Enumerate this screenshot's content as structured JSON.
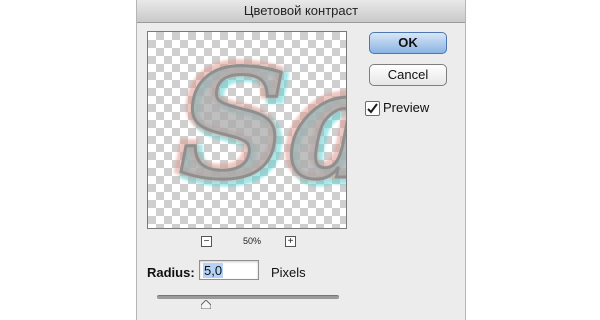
{
  "dialog": {
    "title": "Цветовой контраст",
    "ok_label": "OK",
    "cancel_label": "Cancel",
    "preview_label": "Preview",
    "preview_checked": true
  },
  "preview": {
    "sample_text": "Sa",
    "zoom_level": "50%",
    "zoom_out_icon": "minus-icon",
    "zoom_in_icon": "plus-icon"
  },
  "radius": {
    "label": "Radius:",
    "value": "5,0",
    "units": "Pixels",
    "slider_fraction": 0.27
  },
  "colors": {
    "default_button": "#8ab3e4",
    "checker": "#cfcfcf"
  }
}
